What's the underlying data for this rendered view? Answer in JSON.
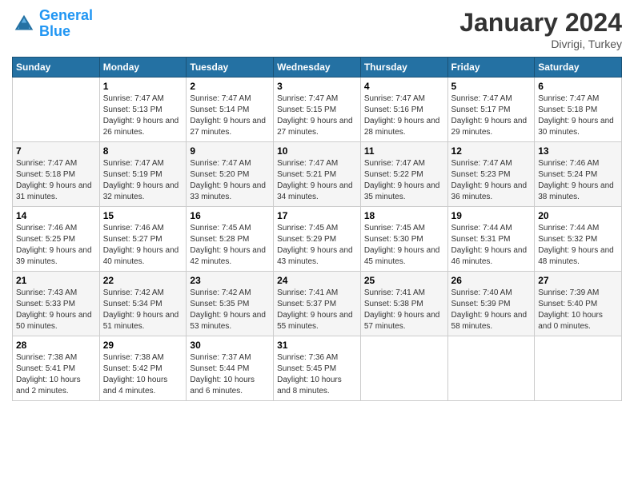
{
  "header": {
    "logo_line1": "General",
    "logo_line2": "Blue",
    "month_title": "January 2024",
    "location": "Divrigi, Turkey"
  },
  "weekdays": [
    "Sunday",
    "Monday",
    "Tuesday",
    "Wednesday",
    "Thursday",
    "Friday",
    "Saturday"
  ],
  "weeks": [
    [
      {
        "day": "",
        "sunrise": "",
        "sunset": "",
        "daylight": ""
      },
      {
        "day": "1",
        "sunrise": "Sunrise: 7:47 AM",
        "sunset": "Sunset: 5:13 PM",
        "daylight": "Daylight: 9 hours and 26 minutes."
      },
      {
        "day": "2",
        "sunrise": "Sunrise: 7:47 AM",
        "sunset": "Sunset: 5:14 PM",
        "daylight": "Daylight: 9 hours and 27 minutes."
      },
      {
        "day": "3",
        "sunrise": "Sunrise: 7:47 AM",
        "sunset": "Sunset: 5:15 PM",
        "daylight": "Daylight: 9 hours and 27 minutes."
      },
      {
        "day": "4",
        "sunrise": "Sunrise: 7:47 AM",
        "sunset": "Sunset: 5:16 PM",
        "daylight": "Daylight: 9 hours and 28 minutes."
      },
      {
        "day": "5",
        "sunrise": "Sunrise: 7:47 AM",
        "sunset": "Sunset: 5:17 PM",
        "daylight": "Daylight: 9 hours and 29 minutes."
      },
      {
        "day": "6",
        "sunrise": "Sunrise: 7:47 AM",
        "sunset": "Sunset: 5:18 PM",
        "daylight": "Daylight: 9 hours and 30 minutes."
      }
    ],
    [
      {
        "day": "7",
        "sunrise": "Sunrise: 7:47 AM",
        "sunset": "Sunset: 5:18 PM",
        "daylight": "Daylight: 9 hours and 31 minutes."
      },
      {
        "day": "8",
        "sunrise": "Sunrise: 7:47 AM",
        "sunset": "Sunset: 5:19 PM",
        "daylight": "Daylight: 9 hours and 32 minutes."
      },
      {
        "day": "9",
        "sunrise": "Sunrise: 7:47 AM",
        "sunset": "Sunset: 5:20 PM",
        "daylight": "Daylight: 9 hours and 33 minutes."
      },
      {
        "day": "10",
        "sunrise": "Sunrise: 7:47 AM",
        "sunset": "Sunset: 5:21 PM",
        "daylight": "Daylight: 9 hours and 34 minutes."
      },
      {
        "day": "11",
        "sunrise": "Sunrise: 7:47 AM",
        "sunset": "Sunset: 5:22 PM",
        "daylight": "Daylight: 9 hours and 35 minutes."
      },
      {
        "day": "12",
        "sunrise": "Sunrise: 7:47 AM",
        "sunset": "Sunset: 5:23 PM",
        "daylight": "Daylight: 9 hours and 36 minutes."
      },
      {
        "day": "13",
        "sunrise": "Sunrise: 7:46 AM",
        "sunset": "Sunset: 5:24 PM",
        "daylight": "Daylight: 9 hours and 38 minutes."
      }
    ],
    [
      {
        "day": "14",
        "sunrise": "Sunrise: 7:46 AM",
        "sunset": "Sunset: 5:25 PM",
        "daylight": "Daylight: 9 hours and 39 minutes."
      },
      {
        "day": "15",
        "sunrise": "Sunrise: 7:46 AM",
        "sunset": "Sunset: 5:27 PM",
        "daylight": "Daylight: 9 hours and 40 minutes."
      },
      {
        "day": "16",
        "sunrise": "Sunrise: 7:45 AM",
        "sunset": "Sunset: 5:28 PM",
        "daylight": "Daylight: 9 hours and 42 minutes."
      },
      {
        "day": "17",
        "sunrise": "Sunrise: 7:45 AM",
        "sunset": "Sunset: 5:29 PM",
        "daylight": "Daylight: 9 hours and 43 minutes."
      },
      {
        "day": "18",
        "sunrise": "Sunrise: 7:45 AM",
        "sunset": "Sunset: 5:30 PM",
        "daylight": "Daylight: 9 hours and 45 minutes."
      },
      {
        "day": "19",
        "sunrise": "Sunrise: 7:44 AM",
        "sunset": "Sunset: 5:31 PM",
        "daylight": "Daylight: 9 hours and 46 minutes."
      },
      {
        "day": "20",
        "sunrise": "Sunrise: 7:44 AM",
        "sunset": "Sunset: 5:32 PM",
        "daylight": "Daylight: 9 hours and 48 minutes."
      }
    ],
    [
      {
        "day": "21",
        "sunrise": "Sunrise: 7:43 AM",
        "sunset": "Sunset: 5:33 PM",
        "daylight": "Daylight: 9 hours and 50 minutes."
      },
      {
        "day": "22",
        "sunrise": "Sunrise: 7:42 AM",
        "sunset": "Sunset: 5:34 PM",
        "daylight": "Daylight: 9 hours and 51 minutes."
      },
      {
        "day": "23",
        "sunrise": "Sunrise: 7:42 AM",
        "sunset": "Sunset: 5:35 PM",
        "daylight": "Daylight: 9 hours and 53 minutes."
      },
      {
        "day": "24",
        "sunrise": "Sunrise: 7:41 AM",
        "sunset": "Sunset: 5:37 PM",
        "daylight": "Daylight: 9 hours and 55 minutes."
      },
      {
        "day": "25",
        "sunrise": "Sunrise: 7:41 AM",
        "sunset": "Sunset: 5:38 PM",
        "daylight": "Daylight: 9 hours and 57 minutes."
      },
      {
        "day": "26",
        "sunrise": "Sunrise: 7:40 AM",
        "sunset": "Sunset: 5:39 PM",
        "daylight": "Daylight: 9 hours and 58 minutes."
      },
      {
        "day": "27",
        "sunrise": "Sunrise: 7:39 AM",
        "sunset": "Sunset: 5:40 PM",
        "daylight": "Daylight: 10 hours and 0 minutes."
      }
    ],
    [
      {
        "day": "28",
        "sunrise": "Sunrise: 7:38 AM",
        "sunset": "Sunset: 5:41 PM",
        "daylight": "Daylight: 10 hours and 2 minutes."
      },
      {
        "day": "29",
        "sunrise": "Sunrise: 7:38 AM",
        "sunset": "Sunset: 5:42 PM",
        "daylight": "Daylight: 10 hours and 4 minutes."
      },
      {
        "day": "30",
        "sunrise": "Sunrise: 7:37 AM",
        "sunset": "Sunset: 5:44 PM",
        "daylight": "Daylight: 10 hours and 6 minutes."
      },
      {
        "day": "31",
        "sunrise": "Sunrise: 7:36 AM",
        "sunset": "Sunset: 5:45 PM",
        "daylight": "Daylight: 10 hours and 8 minutes."
      },
      {
        "day": "",
        "sunrise": "",
        "sunset": "",
        "daylight": ""
      },
      {
        "day": "",
        "sunrise": "",
        "sunset": "",
        "daylight": ""
      },
      {
        "day": "",
        "sunrise": "",
        "sunset": "",
        "daylight": ""
      }
    ]
  ]
}
